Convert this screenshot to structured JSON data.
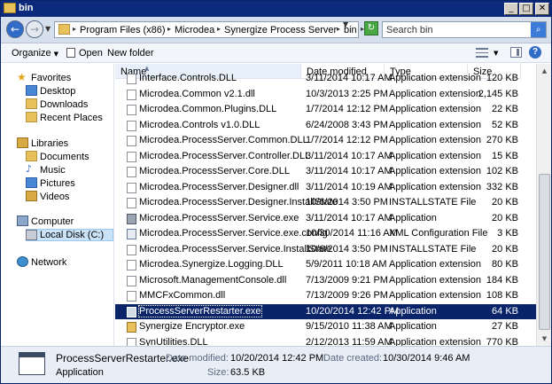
{
  "window": {
    "title": "bin",
    "min": "_",
    "max": "□",
    "close": "✕"
  },
  "address": {
    "crumbs": [
      "Program Files (x86)",
      "Microdea",
      "Synergize Process Server",
      "bin"
    ],
    "search_placeholder": "Search bin"
  },
  "toolbar": {
    "organize": "Organize",
    "open": "Open",
    "new_folder": "New folder"
  },
  "nav": {
    "favorites": "Favorites",
    "desktop": "Desktop",
    "downloads": "Downloads",
    "recent_places": "Recent Places",
    "libraries": "Libraries",
    "documents": "Documents",
    "music": "Music",
    "pictures": "Pictures",
    "videos": "Videos",
    "computer": "Computer",
    "local_disk": "Local Disk (C:)",
    "network": "Network"
  },
  "columns": {
    "name": "Name",
    "date": "Date modified",
    "type": "Type",
    "size": "Size"
  },
  "files": [
    {
      "name": "Interface.Controls.DLL",
      "date": "3/11/2014 10:17 AM",
      "type": "Application extension",
      "size": "120 KB",
      "icon": "dll"
    },
    {
      "name": "Microdea.Common v2.1.dll",
      "date": "10/3/2013 2:25 PM",
      "type": "Application extension",
      "size": "2,145 KB",
      "icon": "dll"
    },
    {
      "name": "Microdea.Common.Plugins.DLL",
      "date": "1/7/2014 12:12 PM",
      "type": "Application extension",
      "size": "22 KB",
      "icon": "dll"
    },
    {
      "name": "Microdea.Controls v1.0.DLL",
      "date": "6/24/2008 3:43 PM",
      "type": "Application extension",
      "size": "52 KB",
      "icon": "dll"
    },
    {
      "name": "Microdea.ProcessServer.Common.DLL",
      "date": "1/7/2014 12:12 PM",
      "type": "Application extension",
      "size": "270 KB",
      "icon": "dll"
    },
    {
      "name": "Microdea.ProcessServer.Controller.DLL",
      "date": "3/11/2014 10:17 AM",
      "type": "Application extension",
      "size": "15 KB",
      "icon": "dll"
    },
    {
      "name": "Microdea.ProcessServer.Core.DLL",
      "date": "3/11/2014 10:17 AM",
      "type": "Application extension",
      "size": "102 KB",
      "icon": "dll"
    },
    {
      "name": "Microdea.ProcessServer.Designer.dll",
      "date": "3/11/2014 10:19 AM",
      "type": "Application extension",
      "size": "332 KB",
      "icon": "dll"
    },
    {
      "name": "Microdea.ProcessServer.Designer.InstallState",
      "date": "10/6/2014 3:50 PM",
      "type": "INSTALLSTATE File",
      "size": "20 KB",
      "icon": "file"
    },
    {
      "name": "Microdea.ProcessServer.Service.exe",
      "date": "3/11/2014 10:17 AM",
      "type": "Application",
      "size": "20 KB",
      "icon": "gear"
    },
    {
      "name": "Microdea.ProcessServer.Service.exe.config",
      "date": "10/30/2014 11:16 AM",
      "type": "XML Configuration File",
      "size": "3 KB",
      "icon": "cfg"
    },
    {
      "name": "Microdea.ProcessServer.Service.InstallState",
      "date": "10/6/2014 3:50 PM",
      "type": "INSTALLSTATE File",
      "size": "20 KB",
      "icon": "file"
    },
    {
      "name": "Microdea.Synergize.Logging.DLL",
      "date": "5/9/2011 10:18 AM",
      "type": "Application extension",
      "size": "80 KB",
      "icon": "dll"
    },
    {
      "name": "Microsoft.ManagementConsole.dll",
      "date": "7/13/2009 9:21 PM",
      "type": "Application extension",
      "size": "184 KB",
      "icon": "dll"
    },
    {
      "name": "MMCFxCommon.dll",
      "date": "7/13/2009 9:26 PM",
      "type": "Application extension",
      "size": "108 KB",
      "icon": "dll"
    },
    {
      "name": "ProcessServerRestarter.exe",
      "date": "10/20/2014 12:42 PM",
      "type": "Application",
      "size": "64 KB",
      "icon": "app",
      "selected": true
    },
    {
      "name": "Synergize Encryptor.exe",
      "date": "9/15/2010 11:38 AM",
      "type": "Application",
      "size": "27 KB",
      "icon": "yellow"
    },
    {
      "name": "SynUtilities.DLL",
      "date": "2/12/2013 11:59 AM",
      "type": "Application extension",
      "size": "770 KB",
      "icon": "dll"
    }
  ],
  "details": {
    "name": "ProcessServerRestarter.exe",
    "kind": "Application",
    "date_modified_label": "Date modified:",
    "date_modified": "10/20/2014 12:42 PM",
    "date_created_label": "Date created:",
    "date_created": "10/30/2014 9:46 AM",
    "size_label": "Size:",
    "size": "63.5 KB"
  }
}
